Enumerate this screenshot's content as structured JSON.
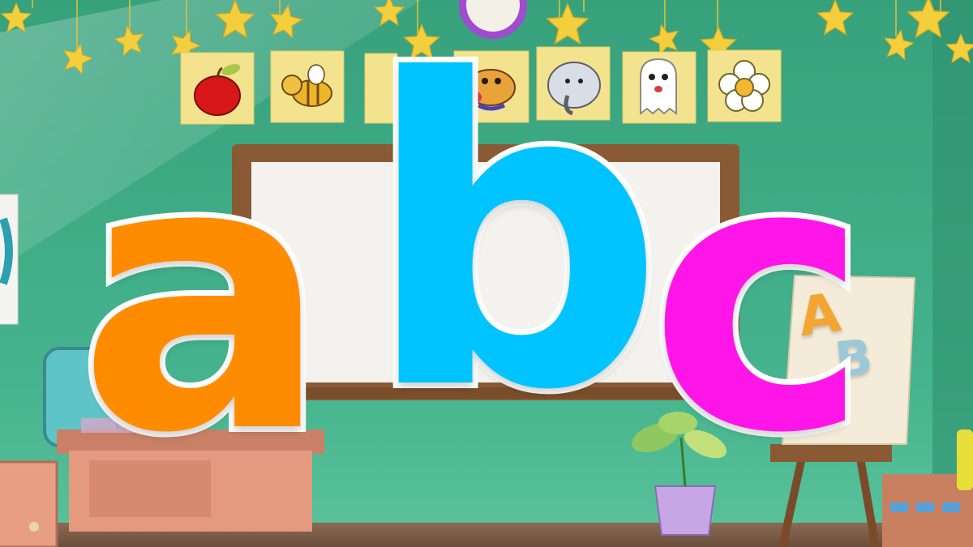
{
  "title_letters": [
    {
      "char": "a",
      "color": "#ff8c00"
    },
    {
      "char": "b",
      "color": "#00c4ff"
    },
    {
      "char": "c",
      "color": "#ff15e8"
    }
  ],
  "outline_color": "#ffffff",
  "easel_letters": [
    "A",
    "B"
  ],
  "easel_letter_colors": [
    "#f2a530",
    "#9cc9d8"
  ],
  "wall_color": "#3fae8a",
  "picture_cards": [
    {
      "icon": "apple-icon"
    },
    {
      "icon": "bee-icon"
    },
    {
      "icon": "dog-icon"
    },
    {
      "icon": "elephant-icon"
    },
    {
      "icon": "ghost-icon"
    },
    {
      "icon": "flower-icon"
    }
  ]
}
